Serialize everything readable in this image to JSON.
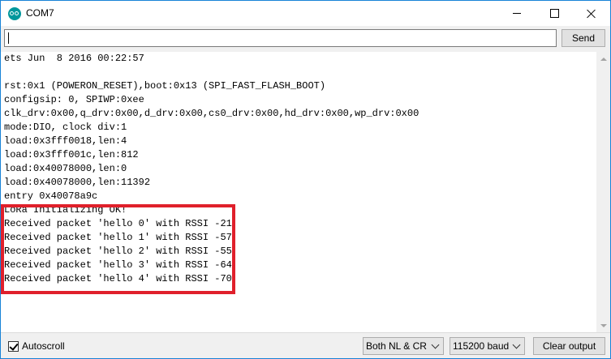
{
  "window": {
    "title": "COM7"
  },
  "toolbar": {
    "input_value": "",
    "send_label": "Send"
  },
  "console": {
    "lines": [
      "ets Jun  8 2016 00:22:57",
      "",
      "rst:0x1 (POWERON_RESET),boot:0x13 (SPI_FAST_FLASH_BOOT)",
      "configsip: 0, SPIWP:0xee",
      "clk_drv:0x00,q_drv:0x00,d_drv:0x00,cs0_drv:0x00,hd_drv:0x00,wp_drv:0x00",
      "mode:DIO, clock div:1",
      "load:0x3fff0018,len:4",
      "load:0x3fff001c,len:812",
      "load:0x40078000,len:0",
      "load:0x40078000,len:11392",
      "entry 0x40078a9c",
      "LoRa Initializing OK!",
      "Received packet 'hello 0' with RSSI -21",
      "Received packet 'hello 1' with RSSI -57",
      "Received packet 'hello 2' with RSSI -55",
      "Received packet 'hello 3' with RSSI -64",
      "Received packet 'hello 4' with RSSI -70"
    ],
    "highlight_color": "#e0202b"
  },
  "statusbar": {
    "autoscroll_label": "Autoscroll",
    "autoscroll_checked": true,
    "line_ending": "Both NL & CR",
    "baud": "115200 baud",
    "clear_label": "Clear output"
  }
}
